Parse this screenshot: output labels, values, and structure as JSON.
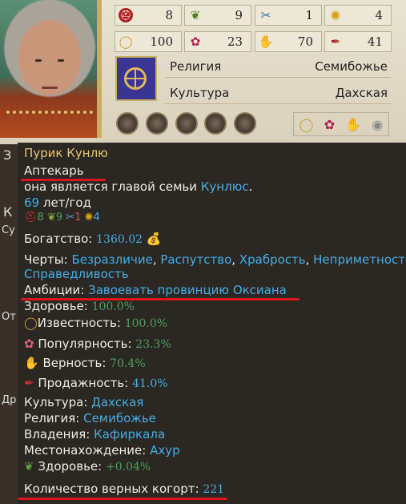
{
  "stats": [
    {
      "icon": "martial-icon",
      "value": "8"
    },
    {
      "icon": "laurel-icon",
      "value": "9"
    },
    {
      "icon": "intrigue-icon",
      "value": "1"
    },
    {
      "icon": "zeal-icon",
      "value": "4"
    },
    {
      "icon": "prominence-icon",
      "value": "100"
    },
    {
      "icon": "popularity-icon",
      "value": "23"
    },
    {
      "icon": "loyalty-icon",
      "value": "70"
    },
    {
      "icon": "corruption-icon",
      "value": "41"
    }
  ],
  "info": {
    "religion_label": "Религия",
    "religion_value": "Семибожье",
    "culture_label": "Культура",
    "culture_value": "Дахская"
  },
  "left_fragments": [
    "З",
    "К",
    "Су",
    "От",
    "Др"
  ],
  "tooltip": {
    "name": "Пурик Кунлю",
    "title": "Аптекарь",
    "family_text": "она является главой семьи",
    "family_name": "Кунлюс",
    "age_value": "69",
    "age_suffix": " лет/год",
    "mini_stats": [
      "8",
      "9",
      "1",
      "4"
    ],
    "wealth_label": "Богатство:",
    "wealth_value": "1360.02",
    "traits_label": "Черты:",
    "traits": [
      "Безразличие",
      "Распутство",
      "Храбрость",
      "Неприметность",
      "Справедливость"
    ],
    "ambition_label": "Амбиции:",
    "ambition_value": "Завоевать провинцию Оксиана",
    "health_label": "Здоровье:",
    "health_value": "100.0%",
    "prominence_label": "Известность:",
    "prominence_value": "100.0%",
    "popularity_label": "Популярность:",
    "popularity_value": "23.3%",
    "loyalty_label": "Верность:",
    "loyalty_value": "70.4%",
    "corruption_label": "Продажность:",
    "corruption_value": "41.0%",
    "culture_label": "Культура:",
    "culture_value": "Дахская",
    "religion_label": "Религия:",
    "religion_value": "Семибожье",
    "holdings_label": "Владения:",
    "holdings_value": "Кафиркала",
    "location_label": "Местонахождение:",
    "location_value": "Ахур",
    "loc_health_label": "Здоровье:",
    "loc_health_value": "+0.04%",
    "cohorts_label": "Количество верных когорт:",
    "cohorts_value": "221"
  },
  "colors": {
    "name": "#e7c672",
    "link": "#44aee6",
    "positive": "#4aa15a",
    "underline": "#e0141c"
  }
}
